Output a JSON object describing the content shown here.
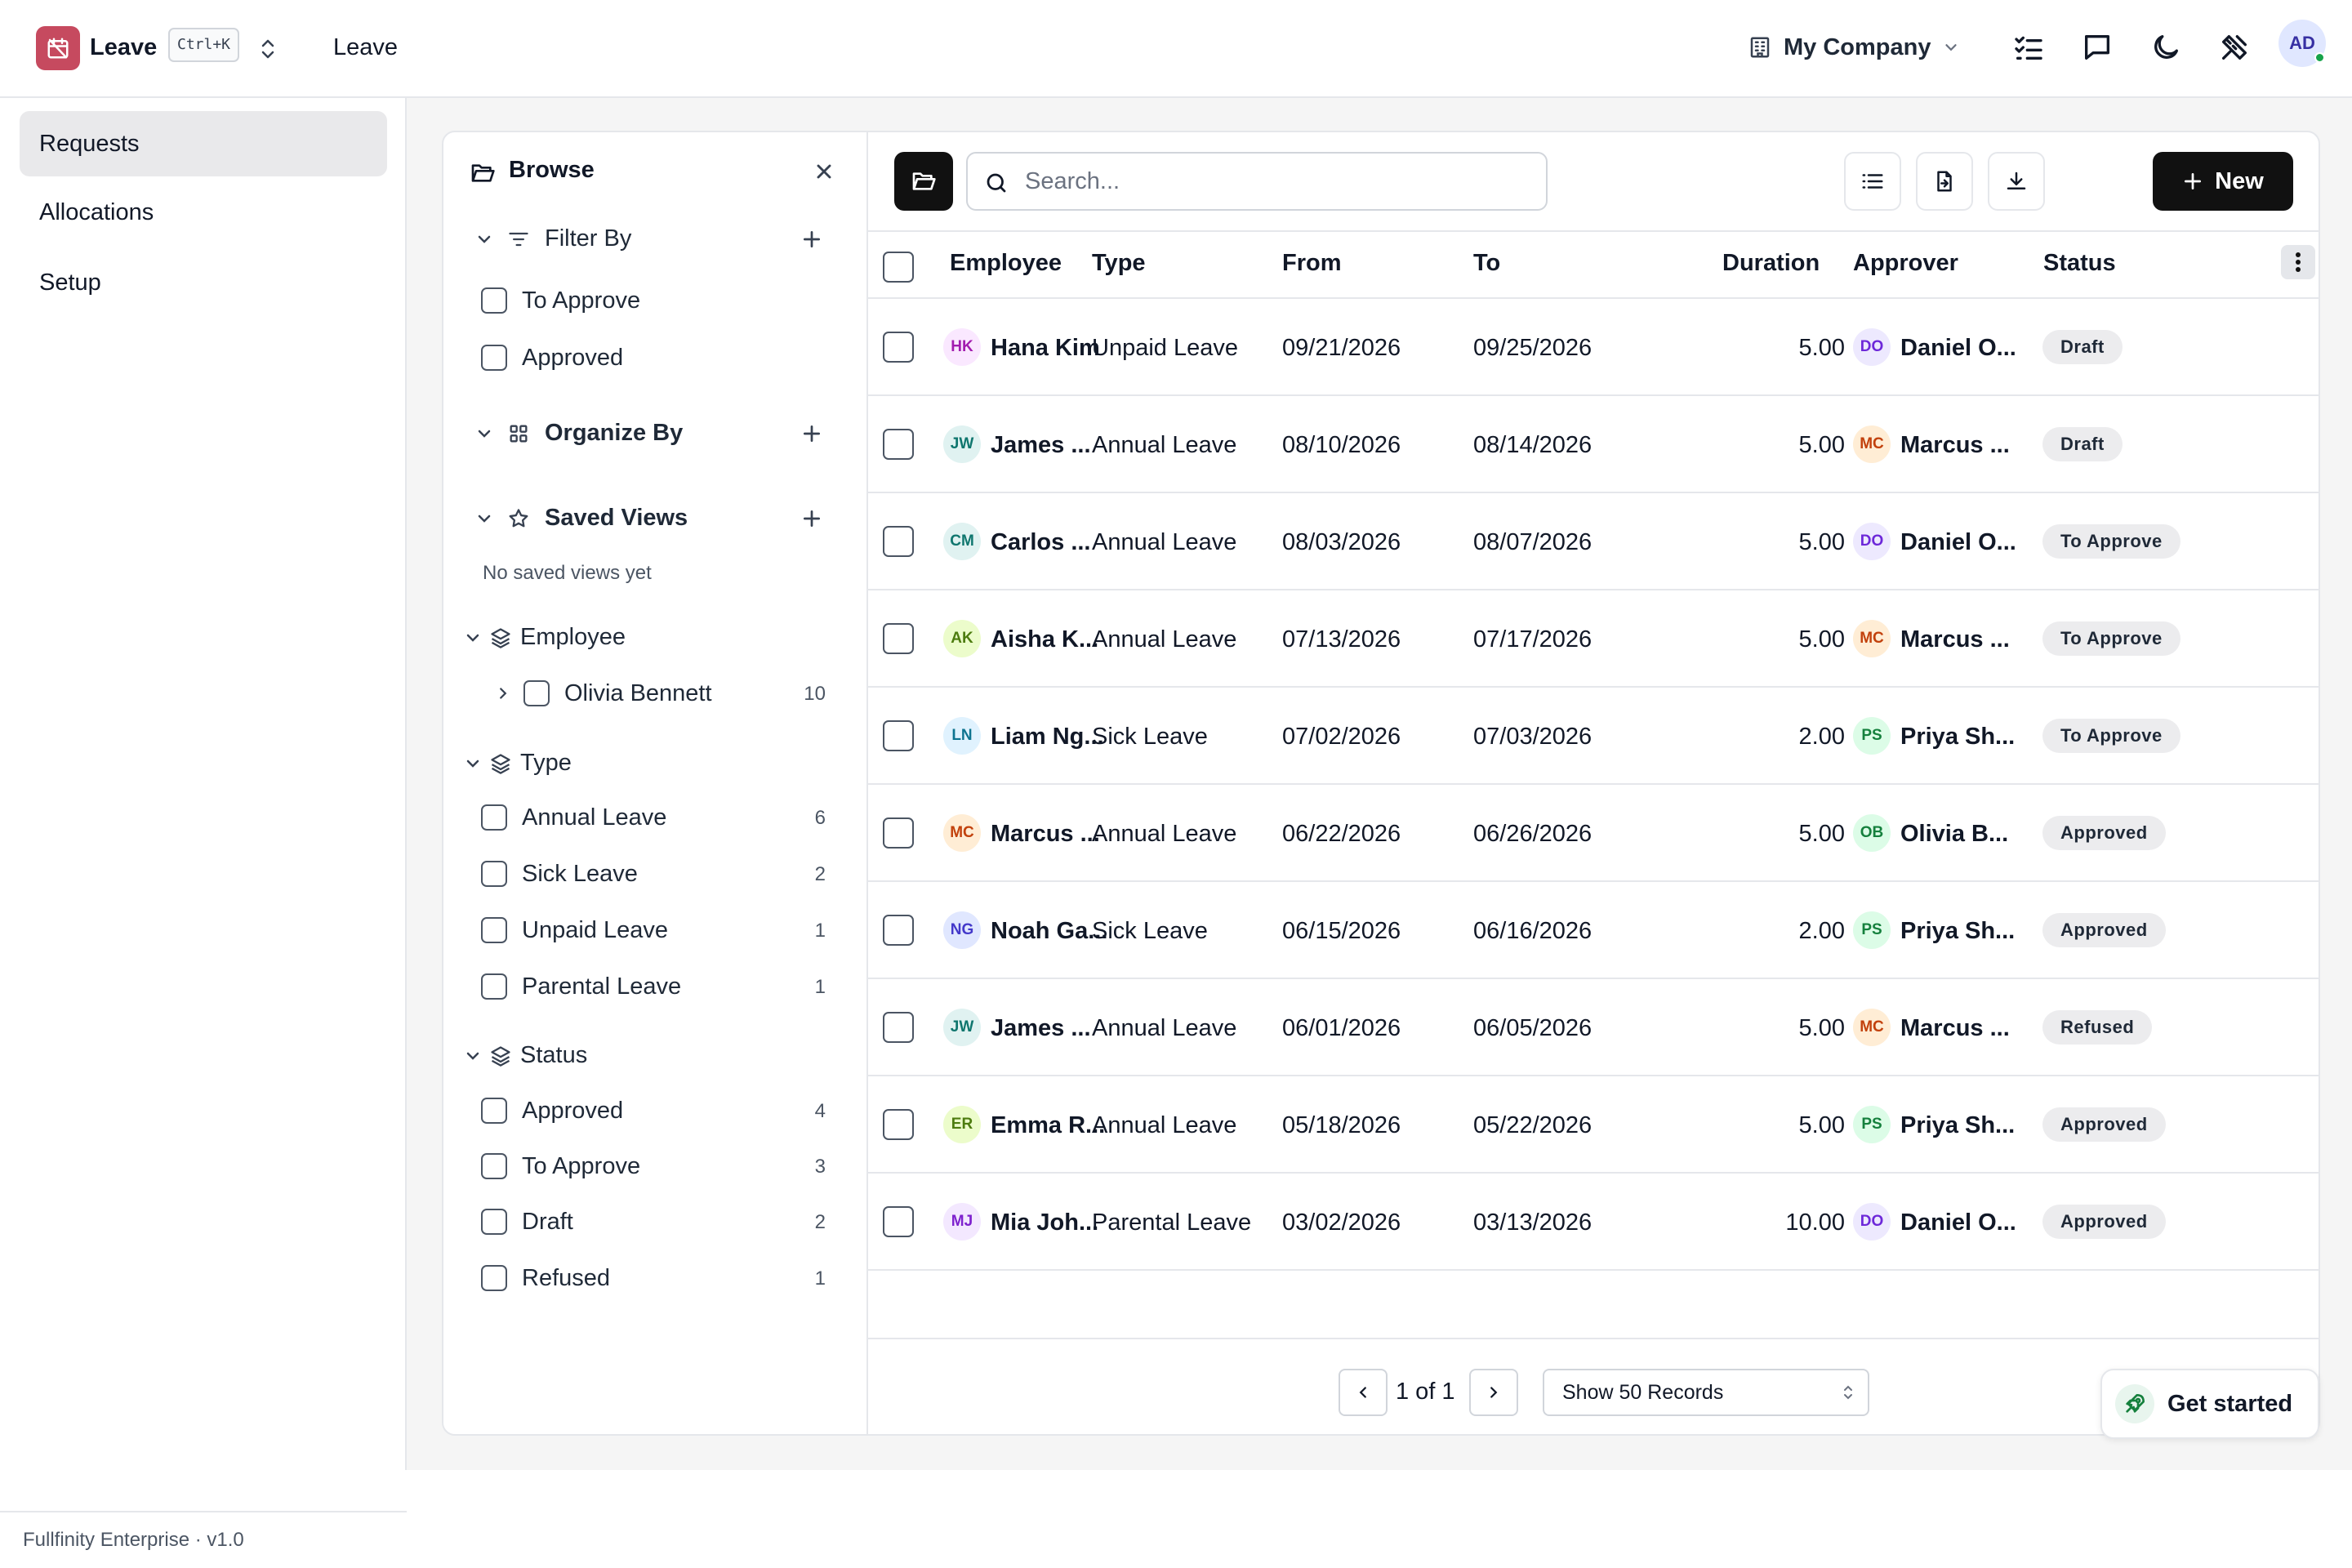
{
  "app": {
    "name": "Leave",
    "shortcut": "Ctrl+K",
    "breadcrumb": "Leave",
    "company": "My Company",
    "user_initials": "AD",
    "accent": "#c64a5f"
  },
  "sidebar": {
    "items": [
      {
        "label": "Requests",
        "active": true
      },
      {
        "label": "Allocations"
      },
      {
        "label": "Setup"
      }
    ],
    "footer": "Fullfinity Enterprise · v1.0"
  },
  "browse": {
    "title": "Browse",
    "filter_by": {
      "label": "Filter By",
      "options": [
        {
          "label": "To Approve"
        },
        {
          "label": "Approved"
        }
      ]
    },
    "organize_by": {
      "label": "Organize By"
    },
    "saved_views": {
      "label": "Saved Views",
      "empty": "No saved views yet"
    },
    "employee": {
      "label": "Employee",
      "options": [
        {
          "label": "Olivia Bennett",
          "count": "10"
        }
      ]
    },
    "type": {
      "label": "Type",
      "options": [
        {
          "label": "Annual Leave",
          "count": "6"
        },
        {
          "label": "Sick Leave",
          "count": "2"
        },
        {
          "label": "Unpaid Leave",
          "count": "1"
        },
        {
          "label": "Parental Leave",
          "count": "1"
        }
      ]
    },
    "status": {
      "label": "Status",
      "options": [
        {
          "label": "Approved",
          "count": "4"
        },
        {
          "label": "To Approve",
          "count": "3"
        },
        {
          "label": "Draft",
          "count": "2"
        },
        {
          "label": "Refused",
          "count": "1"
        }
      ]
    }
  },
  "toolbar": {
    "search_placeholder": "Search...",
    "new_label": "New"
  },
  "table": {
    "columns": {
      "employee": "Employee",
      "type": "Type",
      "from": "From",
      "to": "To",
      "duration": "Duration",
      "approver": "Approver",
      "status": "Status"
    },
    "rows": [
      {
        "emp_ini": "HK",
        "emp_color": "#a21caf",
        "emp_bg": "#fae8ff",
        "employee": "Hana Kim",
        "type": "Unpaid Leave",
        "from": "09/21/2026",
        "to": "09/25/2026",
        "duration": "5.00",
        "appr_ini": "DO",
        "appr_color": "#6d28d9",
        "appr_bg": "#ede9fe",
        "approver": "Daniel O...",
        "status": "Draft"
      },
      {
        "emp_ini": "JW",
        "emp_color": "#0f766e",
        "emp_bg": "#e0f2f1",
        "employee": "James ...",
        "type": "Annual Leave",
        "from": "08/10/2026",
        "to": "08/14/2026",
        "duration": "5.00",
        "appr_ini": "MC",
        "appr_color": "#c2410c",
        "appr_bg": "#ffedd5",
        "approver": "Marcus ...",
        "status": "Draft"
      },
      {
        "emp_ini": "CM",
        "emp_color": "#0f766e",
        "emp_bg": "#e0f2f1",
        "employee": "Carlos ...",
        "type": "Annual Leave",
        "from": "08/03/2026",
        "to": "08/07/2026",
        "duration": "5.00",
        "appr_ini": "DO",
        "appr_color": "#6d28d9",
        "appr_bg": "#ede9fe",
        "approver": "Daniel O...",
        "status": "To Approve"
      },
      {
        "emp_ini": "AK",
        "emp_color": "#4d7c0f",
        "emp_bg": "#ecfccb",
        "employee": "Aisha K...",
        "type": "Annual Leave",
        "from": "07/13/2026",
        "to": "07/17/2026",
        "duration": "5.00",
        "appr_ini": "MC",
        "appr_color": "#c2410c",
        "appr_bg": "#ffedd5",
        "approver": "Marcus ...",
        "status": "To Approve"
      },
      {
        "emp_ini": "LN",
        "emp_color": "#0e7490",
        "emp_bg": "#e0f2fe",
        "employee": "Liam Ng...",
        "type": "Sick Leave",
        "from": "07/02/2026",
        "to": "07/03/2026",
        "duration": "2.00",
        "appr_ini": "PS",
        "appr_color": "#15803d",
        "appr_bg": "#dcfce7",
        "approver": "Priya Sh...",
        "status": "To Approve"
      },
      {
        "emp_ini": "MC",
        "emp_color": "#c2410c",
        "emp_bg": "#ffedd5",
        "employee": "Marcus ...",
        "type": "Annual Leave",
        "from": "06/22/2026",
        "to": "06/26/2026",
        "duration": "5.00",
        "appr_ini": "OB",
        "appr_color": "#15803d",
        "appr_bg": "#dcfce7",
        "approver": "Olivia B...",
        "status": "Approved"
      },
      {
        "emp_ini": "NG",
        "emp_color": "#4338ca",
        "emp_bg": "#e0e7ff",
        "employee": "Noah Ga...",
        "type": "Sick Leave",
        "from": "06/15/2026",
        "to": "06/16/2026",
        "duration": "2.00",
        "appr_ini": "PS",
        "appr_color": "#15803d",
        "appr_bg": "#dcfce7",
        "approver": "Priya Sh...",
        "status": "Approved"
      },
      {
        "emp_ini": "JW",
        "emp_color": "#0f766e",
        "emp_bg": "#e0f2f1",
        "employee": "James ...",
        "type": "Annual Leave",
        "from": "06/01/2026",
        "to": "06/05/2026",
        "duration": "5.00",
        "appr_ini": "MC",
        "appr_color": "#c2410c",
        "appr_bg": "#ffedd5",
        "approver": "Marcus ...",
        "status": "Refused"
      },
      {
        "emp_ini": "ER",
        "emp_color": "#4d7c0f",
        "emp_bg": "#ecfccb",
        "employee": "Emma R...",
        "type": "Annual Leave",
        "from": "05/18/2026",
        "to": "05/22/2026",
        "duration": "5.00",
        "appr_ini": "PS",
        "appr_color": "#15803d",
        "appr_bg": "#dcfce7",
        "approver": "Priya Sh...",
        "status": "Approved"
      },
      {
        "emp_ini": "MJ",
        "emp_color": "#7e22ce",
        "emp_bg": "#f3e8ff",
        "employee": "Mia Joh...",
        "type": "Parental Leave",
        "from": "03/02/2026",
        "to": "03/13/2026",
        "duration": "10.00",
        "appr_ini": "DO",
        "appr_color": "#6d28d9",
        "appr_bg": "#ede9fe",
        "approver": "Daniel O...",
        "status": "Approved"
      }
    ]
  },
  "pagination": {
    "page_text": "1 of 1",
    "page_size": "Show 50 Records"
  },
  "onboarding": {
    "label": "Get started"
  }
}
